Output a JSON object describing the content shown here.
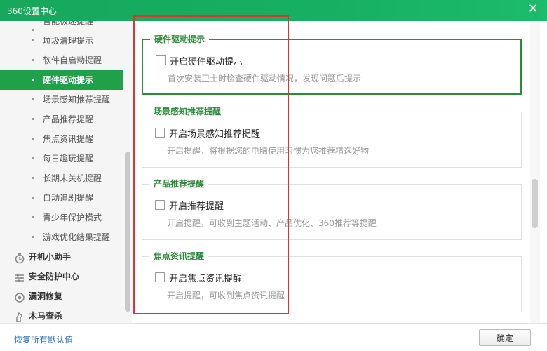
{
  "window": {
    "title": "360设置中心",
    "close_icon": "close-icon"
  },
  "sidebar": {
    "sub_items": [
      {
        "label": "智能极速提醒",
        "partial": true
      },
      {
        "label": "垃圾清理提示"
      },
      {
        "label": "软件自启动提醒"
      },
      {
        "label": "硬件驱动提示",
        "active": true
      },
      {
        "label": "场景感知推荐提醒"
      },
      {
        "label": "产品推荐提醒"
      },
      {
        "label": "焦点资讯提醒"
      },
      {
        "label": "每日趣玩提醒"
      },
      {
        "label": "长期未关机提醒"
      },
      {
        "label": "自动追剧提醒"
      },
      {
        "label": "青少年保护模式"
      },
      {
        "label": "游戏优化结果提醒"
      }
    ],
    "categories": [
      {
        "label": "开机小助手",
        "icon": "timer-icon"
      },
      {
        "label": "安全防护中心",
        "icon": "sliders-icon"
      },
      {
        "label": "漏洞修复",
        "icon": "patch-icon"
      },
      {
        "label": "木马查杀",
        "icon": "trojan-icon"
      }
    ],
    "active_color": "#21a04a"
  },
  "groups": [
    {
      "legend": "硬件驱动提示",
      "checkbox_label": "开启硬件驱动提示",
      "checked": false,
      "description": "首次安装卫士时检查硬件驱动情况，发现问题后提示",
      "highlighted": true
    },
    {
      "legend": "场景感知推荐提醒",
      "checkbox_label": "开启场景感知推荐提醒",
      "checked": false,
      "description": "开启提醒，将根据您的电脑使用习惯为您推荐精选好物"
    },
    {
      "legend": "产品推荐提醒",
      "checkbox_label": "开启推荐提醒",
      "checked": false,
      "description": "开启提醒，可收到主题活动、产品优化、360推荐等提醒"
    },
    {
      "legend": "焦点资讯提醒",
      "checkbox_label": "开启焦点资讯提醒",
      "checked": false,
      "description": "开启提醒，可收到焦点资讯提醒"
    }
  ],
  "footer": {
    "restore_link": "恢复所有默认值",
    "ok_button": "确定"
  },
  "colors": {
    "title_bar": "#17b063",
    "legend": "#2e8b3a",
    "annotation_box": "#e0332e",
    "link": "#2a6fb8"
  }
}
